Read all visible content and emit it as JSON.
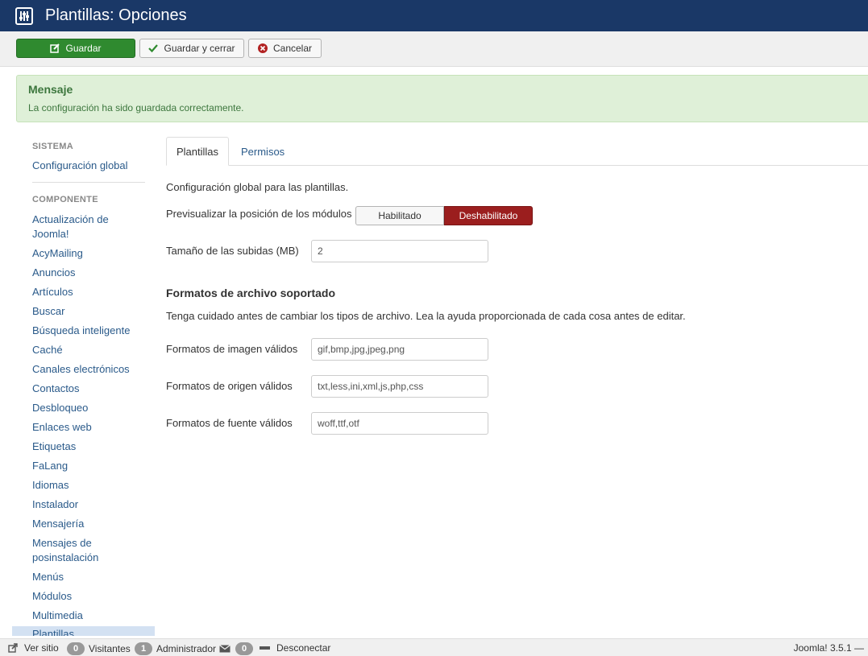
{
  "header": {
    "title": "Plantillas: Opciones",
    "icon": "sliders-icon"
  },
  "toolbar": {
    "save_label": "Guardar",
    "save_close_label": "Guardar y cerrar",
    "cancel_label": "Cancelar"
  },
  "alert": {
    "heading": "Mensaje",
    "message": "La configuración ha sido guardada correctamente."
  },
  "sidebar": {
    "system_heading": "SISTEMA",
    "system_items": [
      "Configuración global"
    ],
    "component_heading": "COMPONENTE",
    "items": [
      "Actualización de Joomla!",
      "AcyMailing",
      "Anuncios",
      "Artículos",
      "Buscar",
      "Búsqueda inteligente",
      "Caché",
      "Canales electrónicos",
      "Contactos",
      "Desbloqueo",
      "Enlaces web",
      "Etiquetas",
      "FaLang",
      "Idiomas",
      "Instalador",
      "Mensajería",
      "Mensajes de posinstalación",
      "Menús",
      "Módulos",
      "Multimedia",
      "Plantillas"
    ]
  },
  "tabs": [
    {
      "label": "Plantillas",
      "active": true
    },
    {
      "label": "Permisos",
      "active": false
    }
  ],
  "form": {
    "intro": "Configuración global para las plantillas.",
    "preview_label": "Previsualizar la posición de los módulos",
    "toggle_on": "Habilitado",
    "toggle_off": "Deshabilitado",
    "upload_label": "Tamaño de las subidas (MB)",
    "upload_value": "2",
    "formats_title": "Formatos de archivo soportado",
    "formats_note": "Tenga cuidado antes de cambiar los tipos de archivo. Lea la ayuda proporcionada de cada cosa antes de editar.",
    "image_label": "Formatos de imagen válidos",
    "image_value": "gif,bmp,jpg,jpeg,png",
    "source_label": "Formatos de origen válidos",
    "source_value": "txt,less,ini,xml,js,php,css",
    "font_label": "Formatos de fuente válidos",
    "font_value": "woff,ttf,otf"
  },
  "statusbar": {
    "view_site": "Ver sitio",
    "visitors_count": "0",
    "visitors_label": "Visitantes",
    "admin_count": "1",
    "admin_label": "Administrador",
    "messages_count": "0",
    "logout": "Desconectar",
    "version": "Joomla! 3.5.1 —"
  },
  "colors": {
    "header_bg": "#1a3867",
    "save_green": "#2f8a2f",
    "disabled_red": "#9b1e1e",
    "alert_bg": "#dff0d8",
    "link_blue": "#2a5a8a"
  }
}
